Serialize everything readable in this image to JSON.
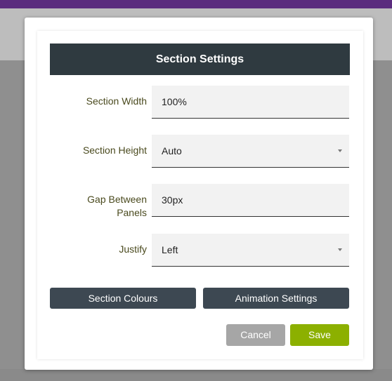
{
  "dialog": {
    "title": "Section Settings",
    "fields": [
      {
        "label": "Section Width",
        "value": "100%"
      },
      {
        "label": "Section Height",
        "value": "Auto"
      },
      {
        "label": "Gap Between Panels",
        "label_line1": "Gap Between",
        "label_line2": "Panels",
        "value": "30px"
      },
      {
        "label": "Justify",
        "value": "Left"
      }
    ],
    "buttons": {
      "section_colours": "Section Colours",
      "animation_settings": "Animation Settings",
      "cancel": "Cancel",
      "save": "Save"
    }
  },
  "colors": {
    "header_bg": "#2f3a40",
    "secondary_button": "#3d4852",
    "cancel_button": "#a6a6a6",
    "save_button": "#8cb000",
    "top_bar": "#5b2c7e"
  },
  "icons": {
    "dropdown": "chevron-down-icon"
  }
}
